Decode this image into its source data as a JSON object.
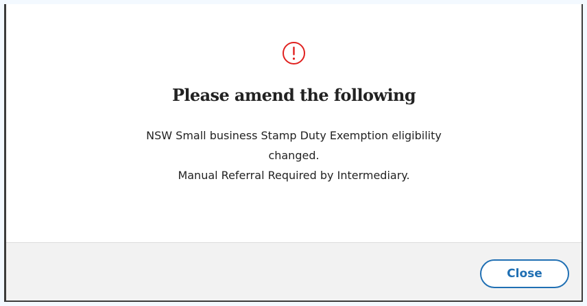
{
  "dialog": {
    "icon": "exclamation-circle-icon",
    "icon_color": "#e0201e",
    "title": "Please amend the following",
    "message_lines": [
      "NSW Small business Stamp Duty Exemption eligibility",
      "changed.",
      "Manual Referral Required by Intermediary."
    ],
    "close_label": "Close",
    "accent_color": "#1f6fb3"
  }
}
